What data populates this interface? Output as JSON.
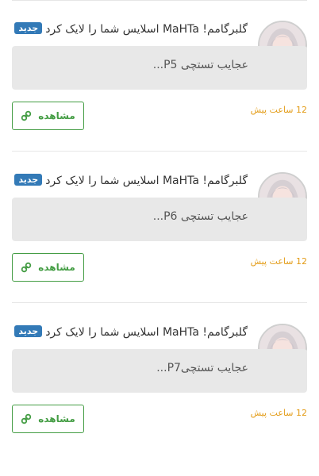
{
  "notifications": [
    {
      "headline": "گلبرگامم! MaHTa اسلایس شما را لایک کرد",
      "badge": "جدید",
      "quote": "عجایب تستچی P5...",
      "button_label": "مشاهده",
      "timestamp": "12 ساعت پیش",
      "avatar_icon": "user-avatar"
    },
    {
      "headline": "گلبرگامم! MaHTa اسلایس شما را لایک کرد",
      "badge": "جدید",
      "quote": "عجایب تستچی P6...",
      "button_label": "مشاهده",
      "timestamp": "12 ساعت پیش",
      "avatar_icon": "user-avatar"
    },
    {
      "headline": "گلبرگامم! MaHTa اسلایس شما را لایک کرد",
      "badge": "جدید",
      "quote": "عجایب تستچیP7...",
      "button_label": "مشاهده",
      "timestamp": "12 ساعت پیش",
      "avatar_icon": "user-avatar"
    }
  ],
  "colors": {
    "badge": "#337ab7",
    "button": "#449d44",
    "timestamp": "#e39c17",
    "quote_bg": "#e8e8e8"
  },
  "icons": {
    "button_icon": "link-icon"
  }
}
